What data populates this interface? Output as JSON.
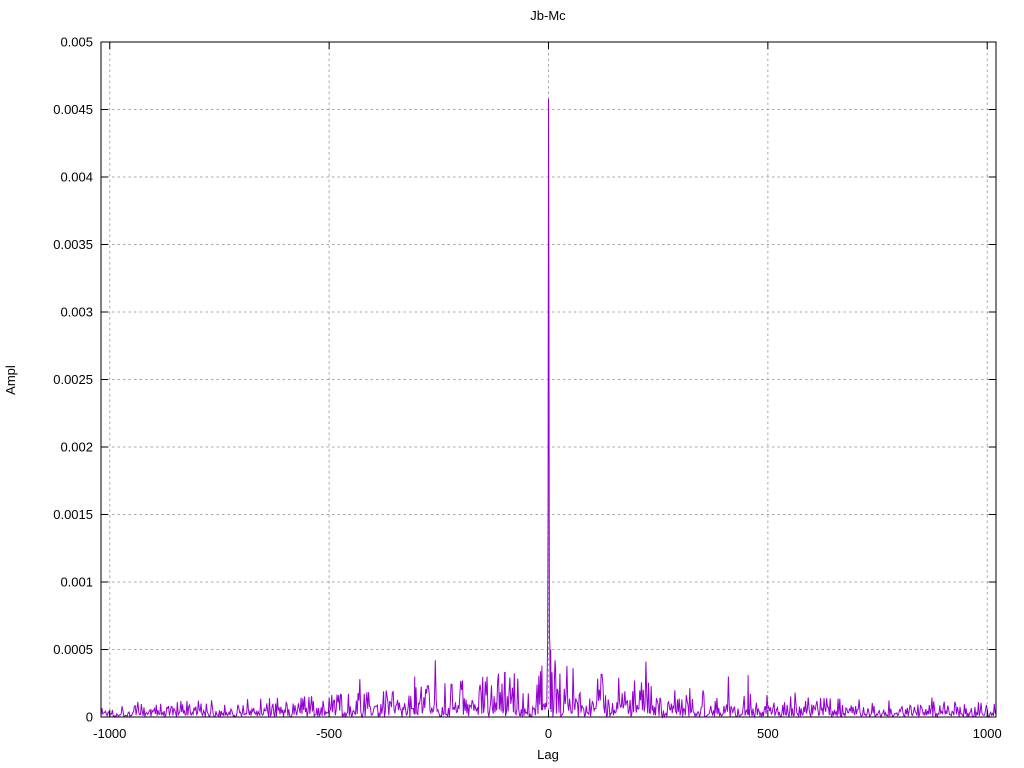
{
  "chart_data": {
    "type": "line",
    "title": "Jb-Mc",
    "xlabel": "Lag",
    "ylabel": "Ampl",
    "xlim": [
      -1020,
      1020
    ],
    "ylim": [
      0,
      0.005
    ],
    "xticks": [
      -1000,
      -500,
      0,
      500,
      1000
    ],
    "xtick_labels": [
      "-1000",
      "-500",
      "0",
      "500",
      "1000"
    ],
    "yticks": [
      0,
      0.0005,
      0.001,
      0.0015,
      0.002,
      0.0025,
      0.003,
      0.0035,
      0.004,
      0.0045,
      0.005
    ],
    "ytick_labels": [
      "0",
      "0.0005",
      "0.001",
      "0.0015",
      "0.002",
      "0.0025",
      "0.003",
      "0.0035",
      "0.004",
      "0.0045",
      "0.005"
    ],
    "grid": true,
    "legend": "none",
    "line_color": "#9400d3",
    "grid_color": "#a8a8a8",
    "border_color": "#000000",
    "background_color": "#ffffff",
    "series": [
      {
        "name": "Jb-Mc",
        "color": "#9400d3",
        "peak_points": [
          {
            "x": -2,
            "y": 0.00055
          },
          {
            "x": -1,
            "y": 0.0015
          },
          {
            "x": 0,
            "y": 0.00458
          },
          {
            "x": 1,
            "y": 0.003
          },
          {
            "x": 2,
            "y": 0.0006
          },
          {
            "x": 3,
            "y": 0.00055
          },
          {
            "x": 5,
            "y": 0.0005
          },
          {
            "x": -15,
            "y": 0.00038
          },
          {
            "x": 15,
            "y": 0.00042
          },
          {
            "x": -99,
            "y": 0.00033
          },
          {
            "x": -140,
            "y": 0.0003
          },
          {
            "x": -258,
            "y": 0.00042
          },
          {
            "x": -305,
            "y": 0.0003
          },
          {
            "x": 120,
            "y": 0.0003
          },
          {
            "x": 410,
            "y": 0.0003
          },
          {
            "x": 455,
            "y": 0.00031
          },
          {
            "x": -430,
            "y": 0.00028
          }
        ],
        "noise_model": {
          "seed": 1337,
          "base": 3.5e-05,
          "amp": 0.00012,
          "decay": 320,
          "cap_mult": 2.7,
          "outlier_prob": 0.008,
          "outlier_mult": 1.6,
          "step": 2
        }
      }
    ]
  }
}
